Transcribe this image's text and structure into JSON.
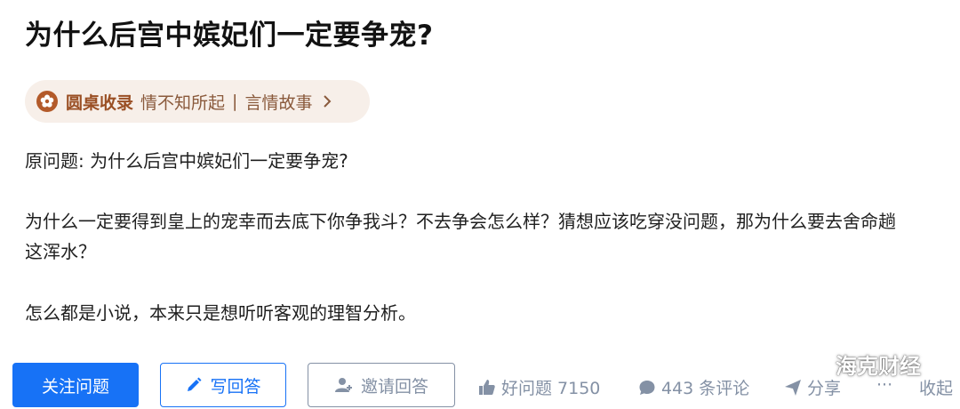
{
  "question": {
    "title": "为什么后宫中嫔妃们一定要争宠?",
    "roundtable": {
      "brand": "圆桌收录",
      "topic_1": "情不知所起",
      "separator": "|",
      "topic_2": "言情故事"
    },
    "body": [
      "原问题: 为什么后宫中嫔妃们一定要争宠?",
      "为什么一定要得到皇上的宠幸而去底下你争我斗？不去争会怎么样？猜想应该吃穿没问题，那为什么要去舍命趟这浑水？",
      "怎么都是小说，本来只是想听听客观的理智分析。"
    ]
  },
  "actions": {
    "follow_label": "关注问题",
    "write_answer_label": "写回答",
    "invite_label": "邀请回答",
    "like_label": "好问题 7150",
    "comment_label": "443 条评论",
    "share_label": "分享",
    "more_label": "···",
    "collapse_label": "收起"
  },
  "watermark": {
    "text": "海克财经"
  },
  "colors": {
    "primary": "#1772f6",
    "roundtable_bg": "#f7efe9",
    "roundtable_brand": "#9a4f24",
    "meta_gray": "#8491a5"
  },
  "icons": [
    "flower-icon",
    "chevron-right-icon",
    "pencil-icon",
    "add-user-icon",
    "thumbs-up-icon",
    "comment-icon",
    "share-icon",
    "wechat-icon"
  ]
}
